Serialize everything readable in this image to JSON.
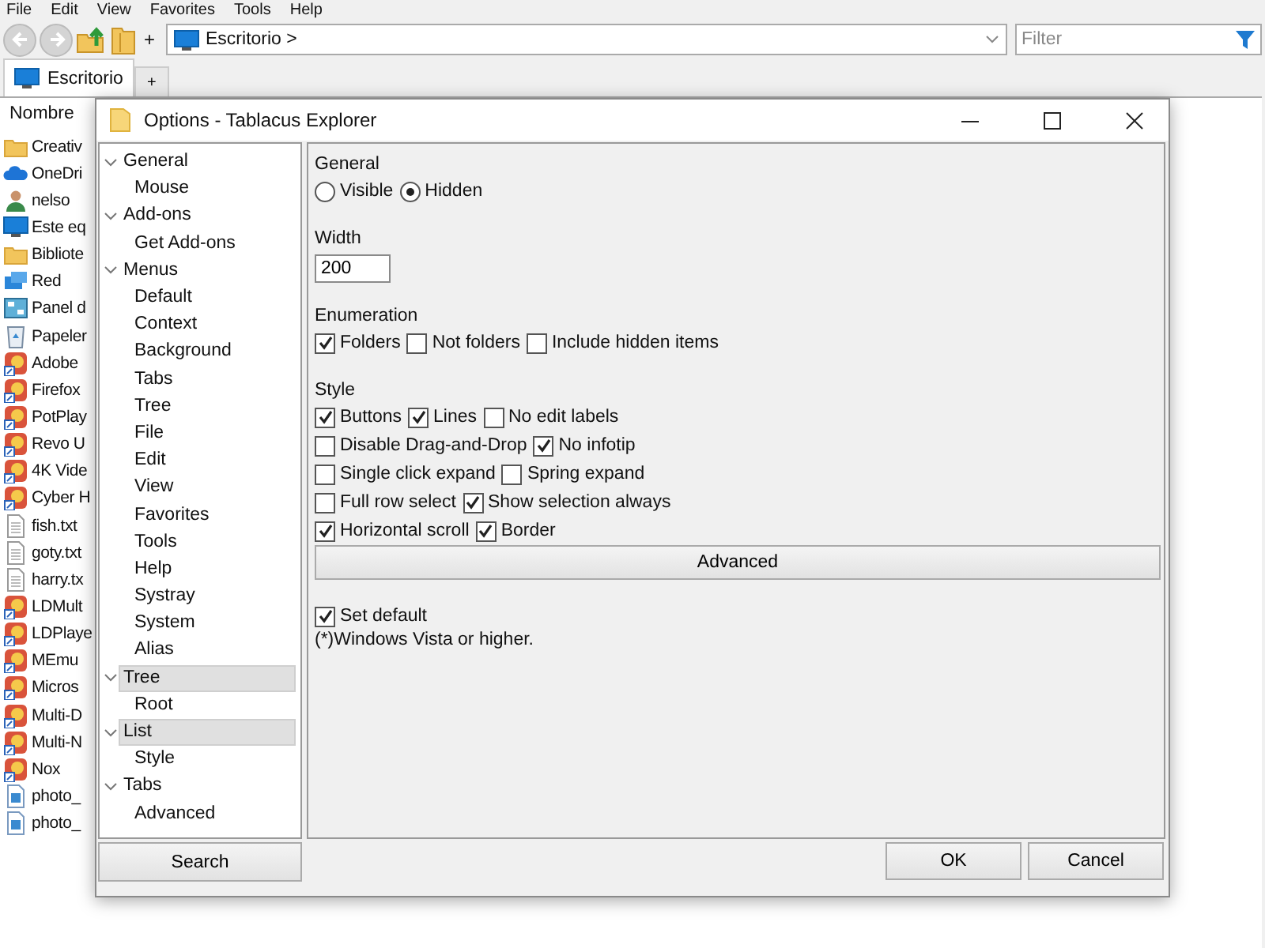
{
  "menu_bar": [
    "File",
    "Edit",
    "View",
    "Favorites",
    "Tools",
    "Help"
  ],
  "new_tab_label": "+",
  "address_bar": {
    "path": "Escritorio >"
  },
  "filter": {
    "placeholder": "Filter"
  },
  "tabs": [
    {
      "label": "Escritorio",
      "selected": true
    }
  ],
  "new_tab_button": "+",
  "file_list": {
    "column": "Nombre",
    "items": [
      {
        "name": "Creativ",
        "kind": "folder"
      },
      {
        "name": "OneDri",
        "kind": "cloud"
      },
      {
        "name": "nelso",
        "kind": "user"
      },
      {
        "name": "Este eq",
        "kind": "computer"
      },
      {
        "name": "Bibliote",
        "kind": "folder"
      },
      {
        "name": "Red",
        "kind": "network"
      },
      {
        "name": "Panel d",
        "kind": "panel"
      },
      {
        "name": "Papeler",
        "kind": "recycle"
      },
      {
        "name": "Adobe",
        "kind": "app"
      },
      {
        "name": "Firefox",
        "kind": "app"
      },
      {
        "name": "PotPlay",
        "kind": "app"
      },
      {
        "name": "Revo U",
        "kind": "app"
      },
      {
        "name": "4K Vide",
        "kind": "app"
      },
      {
        "name": "Cyber H",
        "kind": "app"
      },
      {
        "name": "fish.txt",
        "kind": "text"
      },
      {
        "name": "goty.txt",
        "kind": "text"
      },
      {
        "name": "harry.tx",
        "kind": "text"
      },
      {
        "name": "LDMult",
        "kind": "app"
      },
      {
        "name": "LDPlaye",
        "kind": "app"
      },
      {
        "name": "MEmu",
        "kind": "app"
      },
      {
        "name": "Micros",
        "kind": "app"
      },
      {
        "name": "Multi-D",
        "kind": "app"
      },
      {
        "name": "Multi-N",
        "kind": "app"
      },
      {
        "name": "Nox",
        "kind": "app"
      },
      {
        "name": "photo_",
        "kind": "image"
      },
      {
        "name": "photo_",
        "kind": "image"
      }
    ]
  },
  "dialog": {
    "title": "Options - Tablacus Explorer",
    "tree": [
      {
        "label": "General",
        "selected": false,
        "expanded": true,
        "children": [
          {
            "label": "Mouse",
            "selected": false
          }
        ]
      },
      {
        "label": "Add-ons",
        "selected": false,
        "expanded": true,
        "children": [
          {
            "label": "Get Add-ons",
            "selected": false
          }
        ]
      },
      {
        "label": "Menus",
        "selected": false,
        "expanded": true,
        "children": [
          {
            "label": "Default",
            "selected": false
          },
          {
            "label": "Context",
            "selected": false
          },
          {
            "label": "Background",
            "selected": false
          },
          {
            "label": "Tabs",
            "selected": false
          },
          {
            "label": "Tree",
            "selected": false
          },
          {
            "label": "File",
            "selected": false
          },
          {
            "label": "Edit",
            "selected": false
          },
          {
            "label": "View",
            "selected": false
          },
          {
            "label": "Favorites",
            "selected": false
          },
          {
            "label": "Tools",
            "selected": false
          },
          {
            "label": "Help",
            "selected": false
          },
          {
            "label": "Systray",
            "selected": false
          },
          {
            "label": "System",
            "selected": false
          },
          {
            "label": "Alias",
            "selected": false
          }
        ]
      },
      {
        "label": "Tree",
        "selected": true,
        "expanded": true,
        "children": [
          {
            "label": "Root",
            "selected": false
          }
        ]
      },
      {
        "label": "List",
        "selected": true,
        "expanded": true,
        "children": [
          {
            "label": "Style",
            "selected": false
          }
        ]
      },
      {
        "label": "Tabs",
        "selected": false,
        "expanded": true,
        "children": [
          {
            "label": "Advanced",
            "selected": false
          }
        ]
      }
    ],
    "search_button": "Search",
    "sections": [
      {
        "heading": "General",
        "kind": "radios",
        "options": [
          {
            "label": "Visible",
            "selected": false
          },
          {
            "label": "Hidden",
            "selected": true
          }
        ]
      },
      {
        "heading": "Width",
        "kind": "input",
        "value": "200"
      },
      {
        "heading": "Enumeration",
        "kind": "checks",
        "lines": [
          {
            "options": [
              {
                "label": "Folders",
                "checked": true
              },
              {
                "label": "Not folders",
                "checked": false
              },
              {
                "label": "Include hidden items",
                "checked": false
              }
            ]
          }
        ]
      },
      {
        "heading": "Style",
        "kind": "checks",
        "lines": [
          {
            "options": [
              {
                "label": "Buttons",
                "checked": true
              },
              {
                "label": "Lines",
                "checked": true
              },
              {
                "label": "No edit labels",
                "checked": false
              }
            ]
          },
          {
            "options": [
              {
                "label": "Disable Drag-and-Drop",
                "checked": false
              },
              {
                "label": "No infotip",
                "checked": true
              }
            ]
          },
          {
            "options": [
              {
                "label": "Single click expand",
                "checked": false
              },
              {
                "label": "Spring expand",
                "checked": false
              }
            ]
          },
          {
            "options": [
              {
                "label": "Full row select",
                "checked": false
              },
              {
                "label": "Show selection always",
                "checked": true
              }
            ]
          },
          {
            "options": [
              {
                "label": "Horizontal scroll",
                "checked": true
              },
              {
                "label": "Border",
                "checked": true
              }
            ]
          }
        ]
      }
    ],
    "advanced_button": "Advanced",
    "set_default": {
      "label": "Set default",
      "checked": true
    },
    "note": "(*)Windows Vista or higher.",
    "buttons": [
      "OK",
      "Cancel"
    ]
  }
}
